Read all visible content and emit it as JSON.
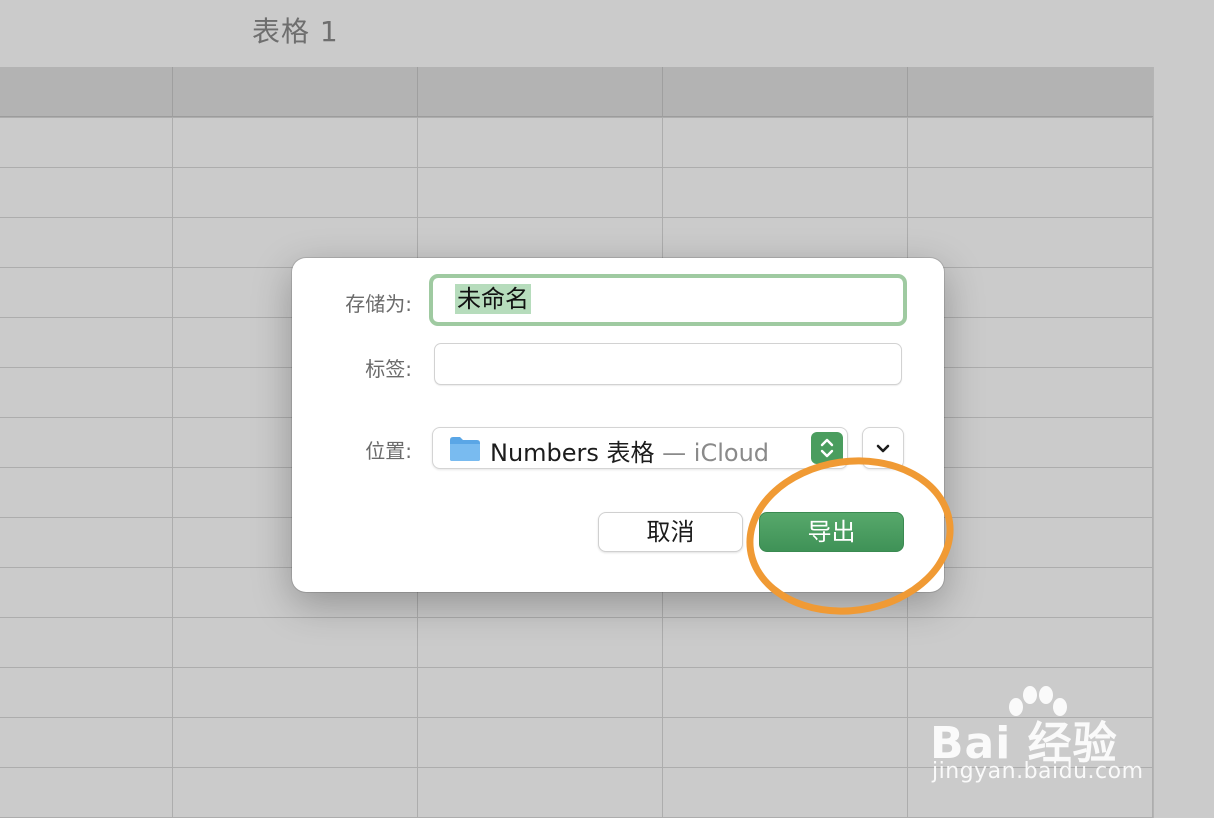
{
  "sheet": {
    "title": "表格 1"
  },
  "dialog": {
    "save_as_label": "存储为:",
    "save_as_value": "未命名",
    "tags_label": "标签:",
    "tags_value": "",
    "location_label": "位置:",
    "location_name": "Numbers 表格",
    "location_sub": " — iCloud",
    "cancel_label": "取消",
    "export_label": "导出"
  },
  "colors": {
    "accent_green": "#4a9d5e",
    "annotation_orange": "#f09a34"
  },
  "icons": [
    "folder-icon",
    "updown-chevron-icon",
    "chevron-down-icon"
  ],
  "watermark": {
    "brand": "Bai 经验",
    "url": "jingyan.baidu.com"
  }
}
